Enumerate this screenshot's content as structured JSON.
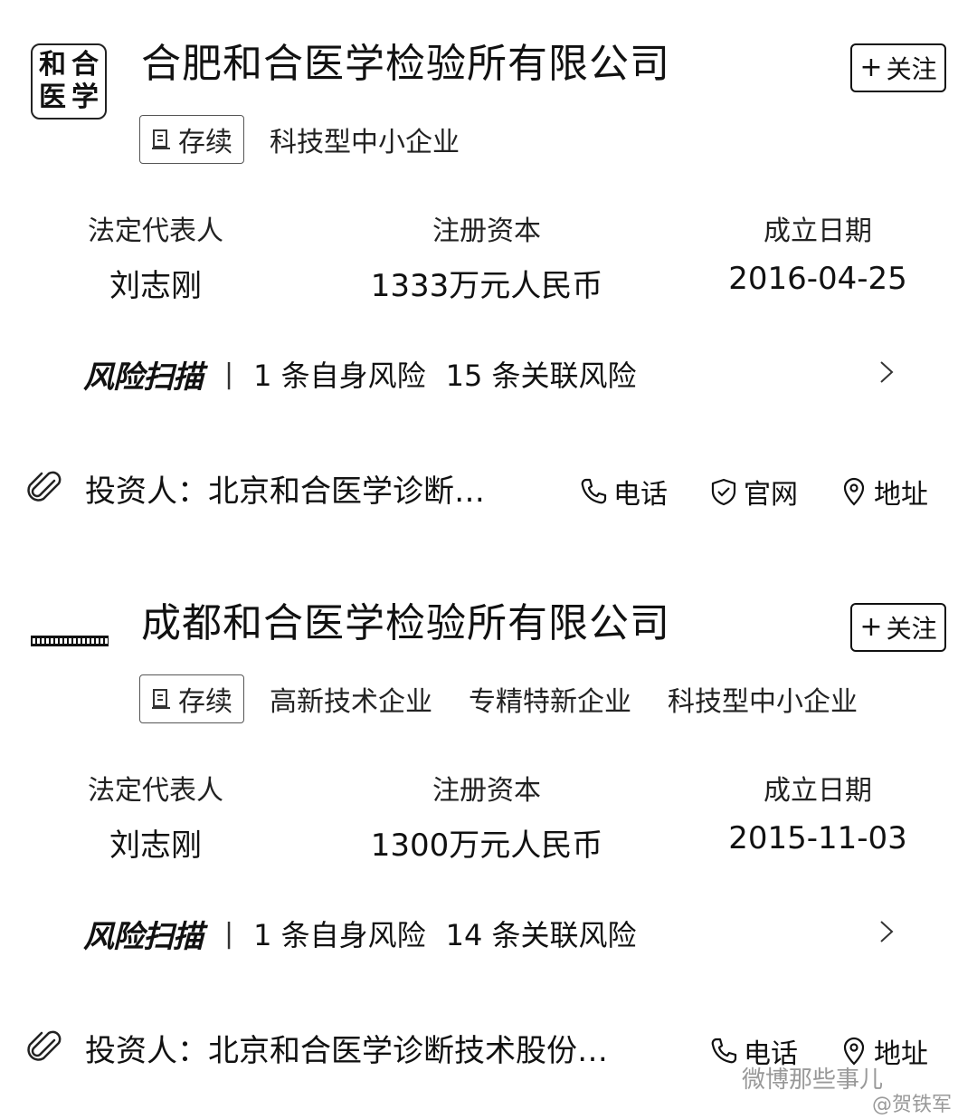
{
  "companies": [
    {
      "name": "合肥和合医学检验所有限公司",
      "logo_text": [
        "和",
        "合",
        "医",
        "学"
      ],
      "follow_label": "关注",
      "status": "存续",
      "tags": [
        "科技型中小企业"
      ],
      "legal_rep_label": "法定代表人",
      "legal_rep": "刘志刚",
      "capital_label": "注册资本",
      "capital": "1333万元人民币",
      "founded_label": "成立日期",
      "founded": "2016-04-25",
      "risk_logo": "风险扫描",
      "risk_self": "1 条自身风险",
      "risk_related": "15 条关联风险",
      "investor": "投资人：北京和合医学诊断…",
      "actions": {
        "phone": "电话",
        "website": "官网",
        "address": "地址"
      }
    },
    {
      "name": "成都和合医学检验所有限公司",
      "follow_label": "关注",
      "status": "存续",
      "tags": [
        "高新技术企业",
        "专精特新企业",
        "科技型中小企业"
      ],
      "legal_rep_label": "法定代表人",
      "legal_rep": "刘志刚",
      "capital_label": "注册资本",
      "capital": "1300万元人民币",
      "founded_label": "成立日期",
      "founded": "2015-11-03",
      "risk_logo": "风险扫描",
      "risk_self": "1 条自身风险",
      "risk_related": "14 条关联风险",
      "investor": "投资人：北京和合医学诊断技术股份…",
      "actions": {
        "phone": "电话",
        "address": "地址"
      }
    }
  ],
  "watermark": {
    "line1": "微博那些事儿",
    "line2": "@贺铁军"
  }
}
